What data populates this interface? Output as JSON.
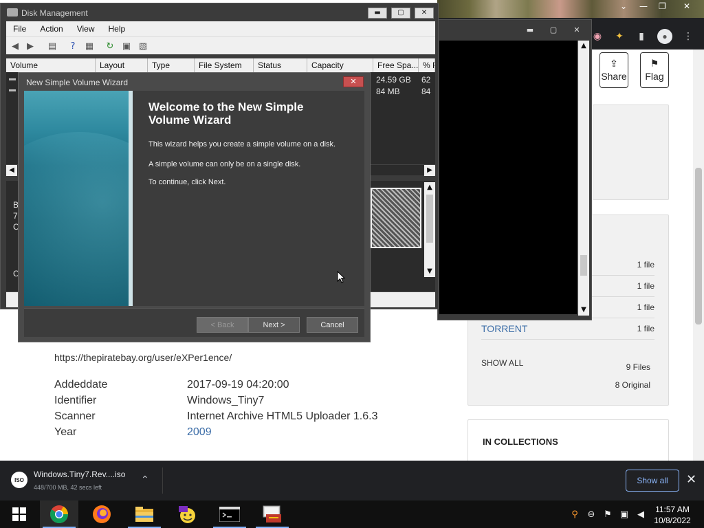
{
  "browser": {
    "share_label": "Share",
    "flag_label": "Flag",
    "download_options": [
      {
        "label": "",
        "count": "1 file"
      },
      {
        "label": "",
        "count": "1 file"
      },
      {
        "label": "",
        "count": "1 file"
      },
      {
        "label": "TORRENT",
        "count": "1 file"
      }
    ],
    "show_all_label": "SHOW ALL",
    "files_count": "9 Files",
    "original_count": "8 Original",
    "collections_heading": "IN COLLECTIONS",
    "source_url": "https://thepiratebay.org/user/eXPer1ence/",
    "metadata": [
      {
        "key": "Addeddate",
        "value": "2017-09-19 04:20:00",
        "link": false
      },
      {
        "key": "Identifier",
        "value": "Windows_Tiny7",
        "link": false
      },
      {
        "key": "Scanner",
        "value": "Internet Archive HTML5 Uploader 1.6.3",
        "link": false
      },
      {
        "key": "Year",
        "value": "2009",
        "link": true
      }
    ]
  },
  "download_bar": {
    "file_icon_text": "ISO",
    "file_name": "Windows.Tiny7.Rev....iso",
    "status": "448/700 MB, 42 secs left",
    "show_all_button": "Show all"
  },
  "disk_management": {
    "title": "Disk Management",
    "menu": [
      "File",
      "Action",
      "View",
      "Help"
    ],
    "columns": [
      "Volume",
      "Layout",
      "Type",
      "File System",
      "Status",
      "Capacity",
      "Free Spa...",
      "% F"
    ],
    "rows": [
      {
        "free_space": "24.59 GB",
        "percent_free": "62"
      },
      {
        "free_space": "84 MB",
        "percent_free": "84"
      }
    ],
    "disk_labels": [
      "B",
      "7.",
      "C",
      "C"
    ]
  },
  "wizard": {
    "title": "New Simple Volume Wizard",
    "heading": "Welcome to the New Simple Volume Wizard",
    "line1": "This wizard helps you create a simple volume on a disk.",
    "line2": "A simple volume can only be on a single disk.",
    "line3": "To continue, click Next.",
    "back_button": "< Back",
    "next_button": "Next >",
    "cancel_button": "Cancel",
    "close_glyph": "✕"
  },
  "taskbar": {
    "clock_time": "11:57 AM",
    "clock_date": "10/8/2022",
    "apps": [
      "start",
      "chrome",
      "firefox",
      "file-explorer",
      "yahoo-messenger",
      "command-prompt",
      "computer-management"
    ]
  },
  "colors": {
    "accent_link": "#3d6ea8",
    "download_button": "#8ab4f8",
    "wizard_close": "#c75050",
    "wizard_banner": "#1b6f85"
  }
}
